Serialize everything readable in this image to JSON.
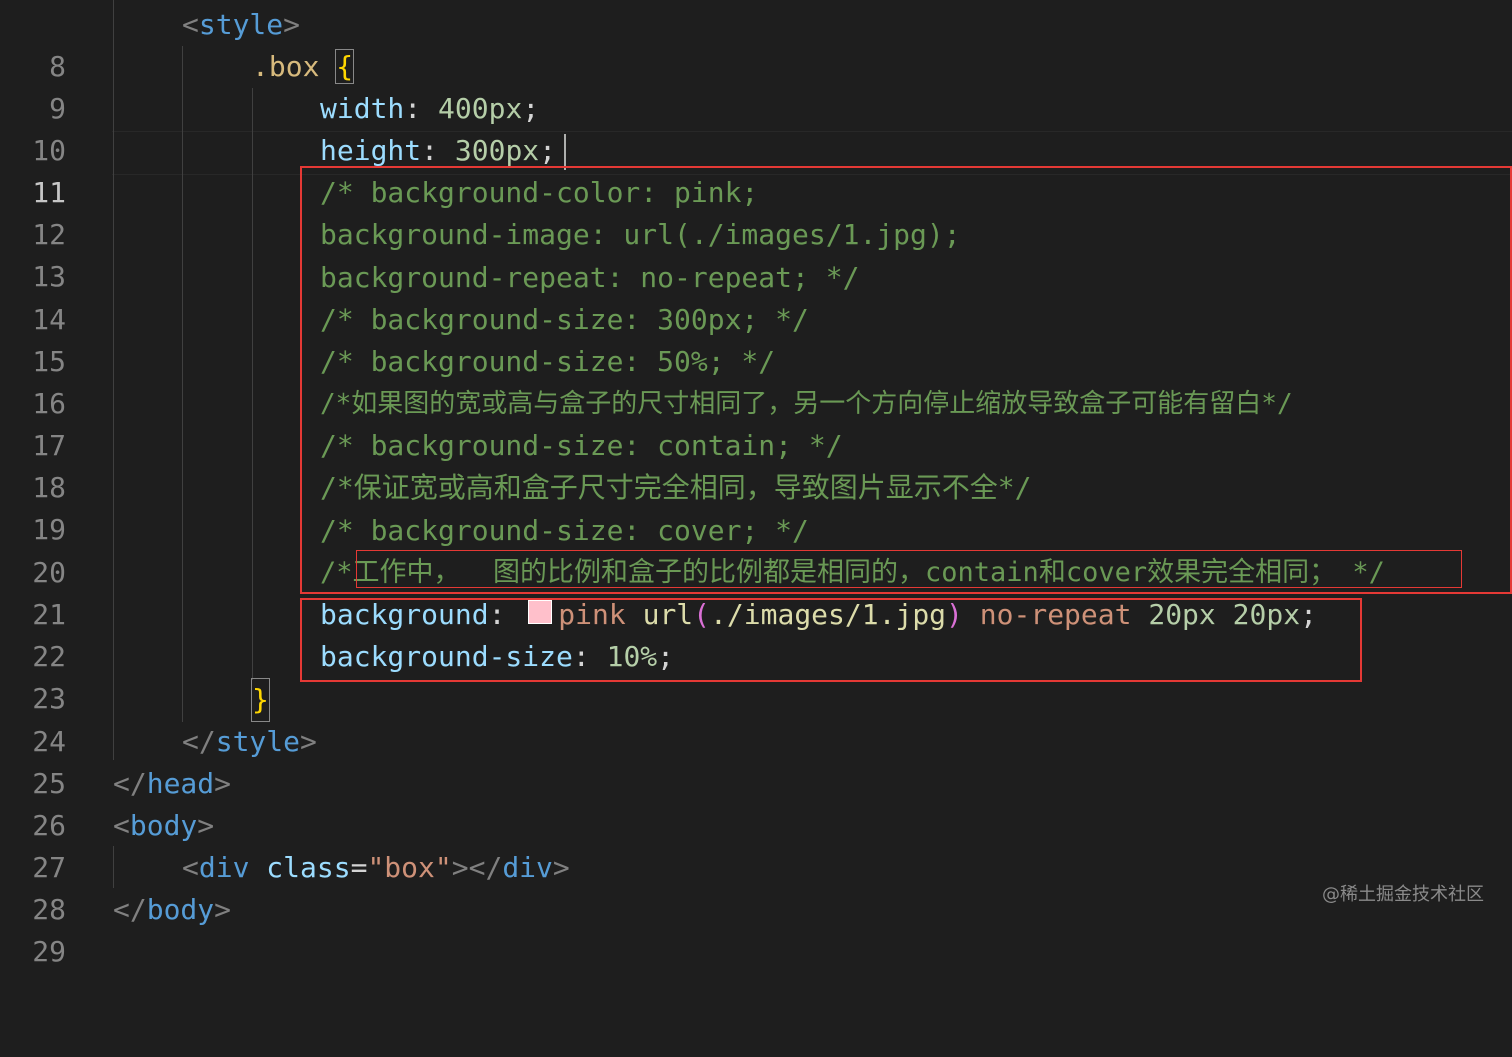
{
  "editor": {
    "active_line": "11",
    "lines": [
      {
        "no": "8",
        "parts": [
          "<",
          "style",
          ">"
        ]
      },
      {
        "no": "9",
        "parts": [
          ".box",
          " ",
          "{"
        ]
      },
      {
        "no": "10",
        "parts": [
          "width",
          ": ",
          "400px",
          ";"
        ]
      },
      {
        "no": "11",
        "parts": [
          "height",
          ": ",
          "300px",
          ";"
        ]
      },
      {
        "no": "12",
        "text": "/* background-color: pink;"
      },
      {
        "no": "13",
        "text": "background-image: url(./images/1.jpg);"
      },
      {
        "no": "14",
        "text": "background-repeat: no-repeat; */"
      },
      {
        "no": "15",
        "text": "/* background-size: 300px; */"
      },
      {
        "no": "16",
        "text": "/* background-size: 50%; */"
      },
      {
        "no": "17",
        "text": "/*如果图的宽或高与盒子的尺寸相同了，另一个方向停止缩放导致盒子可能有留白*/"
      },
      {
        "no": "18",
        "text": "/* background-size: contain; */"
      },
      {
        "no": "19",
        "text": "/*保证宽或高和盒子尺寸完全相同，导致图片显示不全*/"
      },
      {
        "no": "20",
        "text": "/* background-size: cover; */"
      },
      {
        "no": "21",
        "parts": [
          "/*",
          "工作中，  图的比例和盒子的比例都是相同的，contain和cover效果完全相同；",
          " */"
        ]
      },
      {
        "no": "22",
        "parts": [
          "background",
          ": ",
          "pink",
          " url",
          "(",
          "./images/1.jpg",
          ")",
          " no-repeat",
          " 20px",
          " 20px",
          ";"
        ],
        "swatch_color": "#ffc0cb"
      },
      {
        "no": "23",
        "parts": [
          "background-size",
          ": ",
          "10%",
          ";"
        ]
      },
      {
        "no": "24",
        "parts": [
          "}"
        ]
      },
      {
        "no": "25",
        "parts": [
          "</",
          "style",
          ">"
        ]
      },
      {
        "no": "26",
        "parts": [
          "</",
          "head",
          ">"
        ]
      },
      {
        "no": "27",
        "parts": [
          "<",
          "body",
          ">"
        ]
      },
      {
        "no": "28",
        "parts": [
          "<",
          "div",
          " class",
          "=",
          "\"box\"",
          "></",
          "div",
          ">"
        ]
      },
      {
        "no": "29",
        "parts": [
          "</",
          "body",
          ">"
        ]
      }
    ]
  },
  "watermark": "@稀土掘金技术社区",
  "colors": {
    "background": "#1e1e1e",
    "highlight_box": "#e53935",
    "comment": "#6a9955",
    "property": "#9cdcfe"
  }
}
